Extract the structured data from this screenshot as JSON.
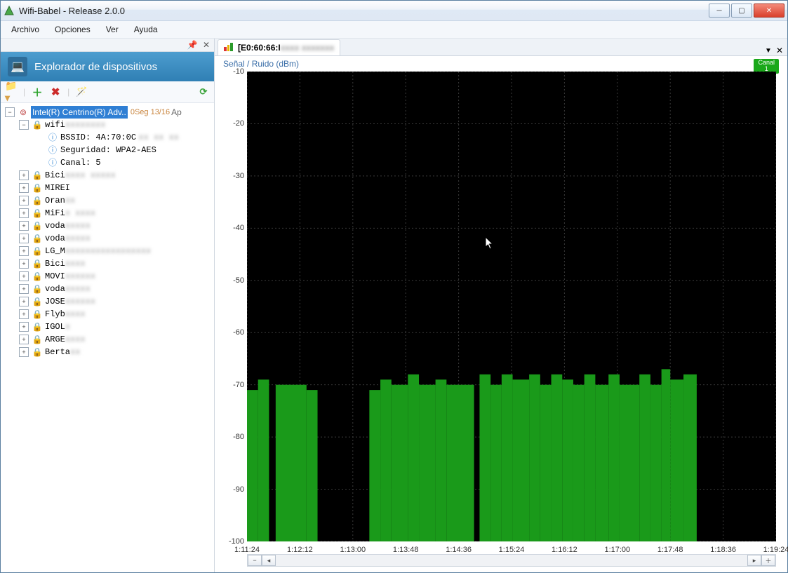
{
  "window": {
    "title": "Wifi-Babel - Release 2.0.0"
  },
  "menu": {
    "items": [
      "Archivo",
      "Opciones",
      "Ver",
      "Ayuda"
    ]
  },
  "left": {
    "header": "Explorador de dispositivos",
    "adapter": "Intel(R) Centrino(R) Adv..",
    "adapter_meta": "0Seg 13/16",
    "adapter_ap": "Ap",
    "sel_net": "wifi",
    "sel_net_blur": "xxxxxxxx",
    "bssid_label": "BSSID: 4A:70:0C",
    "bssid_blur": "xx xx xx",
    "security": "Seguridad: WPA2-AES",
    "channel": "Canal: 5",
    "nets": [
      {
        "name": "Bici",
        "blur": "xxxx xxxxx"
      },
      {
        "name": "MIREI",
        "blur": ""
      },
      {
        "name": "Oran",
        "blur": "xx"
      },
      {
        "name": "MiFi",
        "blur": "x xxxx"
      },
      {
        "name": "voda",
        "blur": "xxxxx"
      },
      {
        "name": "voda",
        "blur": "xxxxx"
      },
      {
        "name": "LG_M",
        "blur": "xxxxxxxxxxxxxxxxx"
      },
      {
        "name": "Bici",
        "blur": "xxxx"
      },
      {
        "name": "MOVI",
        "blur": "xxxxxx"
      },
      {
        "name": "voda",
        "blur": "xxxxx"
      },
      {
        "name": "JOSE",
        "blur": "xxxxxx"
      },
      {
        "name": "Flyb",
        "blur": "xxxx"
      },
      {
        "name": "IGOL",
        "blur": "x"
      },
      {
        "name": "ARGE",
        "blur": "xxxx"
      },
      {
        "name": "Berta",
        "blur": "xx"
      }
    ]
  },
  "right": {
    "tab_prefix": "[E0:60:66:I",
    "tab_blur": "xxxx xxxxxxx",
    "chart_title": "Señal / Ruido (dBm)",
    "canal_label": "Canal",
    "canal_value": "1"
  },
  "chart_data": {
    "type": "bar",
    "ylabel": "Señal / Ruido (dBm)",
    "ylim": [
      -100,
      -10
    ],
    "yticks": [
      -10,
      -20,
      -30,
      -40,
      -50,
      -60,
      -70,
      -80,
      -90,
      -100
    ],
    "xticks": [
      "1:11:24",
      "1:12:12",
      "1:13:00",
      "1:13:48",
      "1:14:36",
      "1:15:24",
      "1:16:12",
      "1:17:00",
      "1:17:48",
      "1:18:36",
      "1:19:24"
    ],
    "x_range_sec": [
      4284,
      4764
    ],
    "series": [
      {
        "name": "Señal",
        "color": "#1a9a1a",
        "bars": [
          {
            "x0": 4284,
            "x1": 4294,
            "v": -71
          },
          {
            "x0": 4294,
            "x1": 4304,
            "v": -69
          },
          {
            "x0": 4310,
            "x1": 4338,
            "v": -70
          },
          {
            "x0": 4338,
            "x1": 4348,
            "v": -71
          },
          {
            "x0": 4395,
            "x1": 4405,
            "v": -71
          },
          {
            "x0": 4405,
            "x1": 4415,
            "v": -69
          },
          {
            "x0": 4415,
            "x1": 4430,
            "v": -70
          },
          {
            "x0": 4430,
            "x1": 4440,
            "v": -68
          },
          {
            "x0": 4440,
            "x1": 4455,
            "v": -70
          },
          {
            "x0": 4455,
            "x1": 4465,
            "v": -69
          },
          {
            "x0": 4465,
            "x1": 4490,
            "v": -70
          },
          {
            "x0": 4495,
            "x1": 4505,
            "v": -68
          },
          {
            "x0": 4505,
            "x1": 4515,
            "v": -70
          },
          {
            "x0": 4515,
            "x1": 4525,
            "v": -68
          },
          {
            "x0": 4525,
            "x1": 4540,
            "v": -69
          },
          {
            "x0": 4540,
            "x1": 4550,
            "v": -68
          },
          {
            "x0": 4550,
            "x1": 4560,
            "v": -70
          },
          {
            "x0": 4560,
            "x1": 4570,
            "v": -68
          },
          {
            "x0": 4570,
            "x1": 4580,
            "v": -69
          },
          {
            "x0": 4580,
            "x1": 4590,
            "v": -70
          },
          {
            "x0": 4590,
            "x1": 4600,
            "v": -68
          },
          {
            "x0": 4600,
            "x1": 4612,
            "v": -70
          },
          {
            "x0": 4612,
            "x1": 4622,
            "v": -68
          },
          {
            "x0": 4622,
            "x1": 4640,
            "v": -70
          },
          {
            "x0": 4640,
            "x1": 4650,
            "v": -68
          },
          {
            "x0": 4650,
            "x1": 4660,
            "v": -70
          },
          {
            "x0": 4660,
            "x1": 4668,
            "v": -67
          },
          {
            "x0": 4668,
            "x1": 4680,
            "v": -69
          },
          {
            "x0": 4680,
            "x1": 4692,
            "v": -68
          }
        ]
      }
    ]
  }
}
